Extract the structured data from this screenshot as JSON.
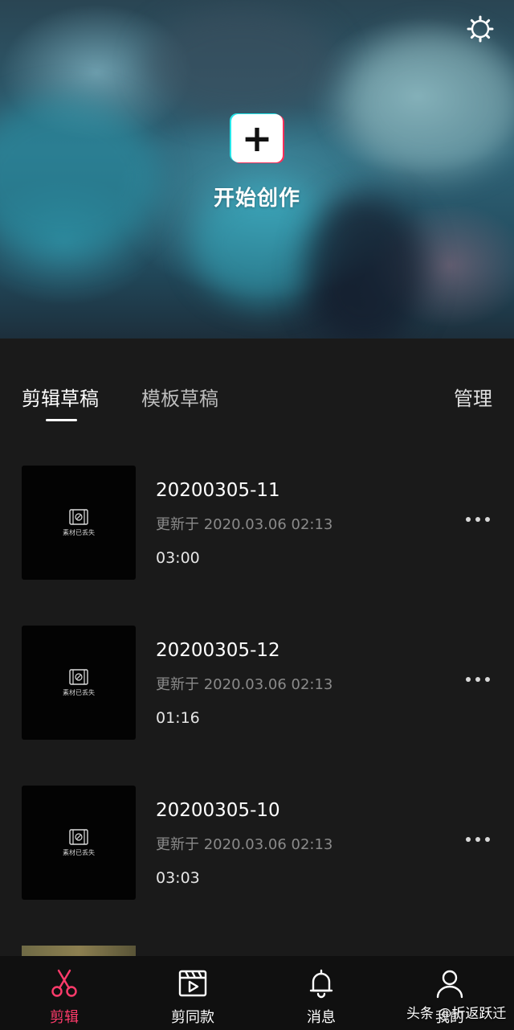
{
  "hero": {
    "create_label": "开始创作",
    "settings_icon": "gear-icon",
    "create_icon": "plus-icon"
  },
  "tabs": {
    "items": [
      {
        "label": "剪辑草稿",
        "active": true
      },
      {
        "label": "模板草稿",
        "active": false
      }
    ],
    "manage_label": "管理"
  },
  "drafts": [
    {
      "title": "20200305-11",
      "updated": "更新于 2020.03.06 02:13",
      "duration": "03:00",
      "thumb_text": "素材已丢失"
    },
    {
      "title": "20200305-12",
      "updated": "更新于 2020.03.06 02:13",
      "duration": "01:16",
      "thumb_text": "素材已丢失"
    },
    {
      "title": "20200305-10",
      "updated": "更新于 2020.03.06 02:13",
      "duration": "03:03",
      "thumb_text": "素材已丢失"
    }
  ],
  "bottom_nav": [
    {
      "label": "剪辑",
      "icon": "scissors-icon",
      "active": true
    },
    {
      "label": "剪同款",
      "icon": "clapperboard-icon",
      "active": false
    },
    {
      "label": "消息",
      "icon": "bell-icon",
      "active": false
    },
    {
      "label": "我的",
      "icon": "user-icon",
      "active": false
    }
  ],
  "watermark": "头条 @折返跃迁",
  "colors": {
    "background": "#1a1a1a",
    "accent": "#ff3b6b",
    "secondary_text": "#8a8a8a"
  }
}
